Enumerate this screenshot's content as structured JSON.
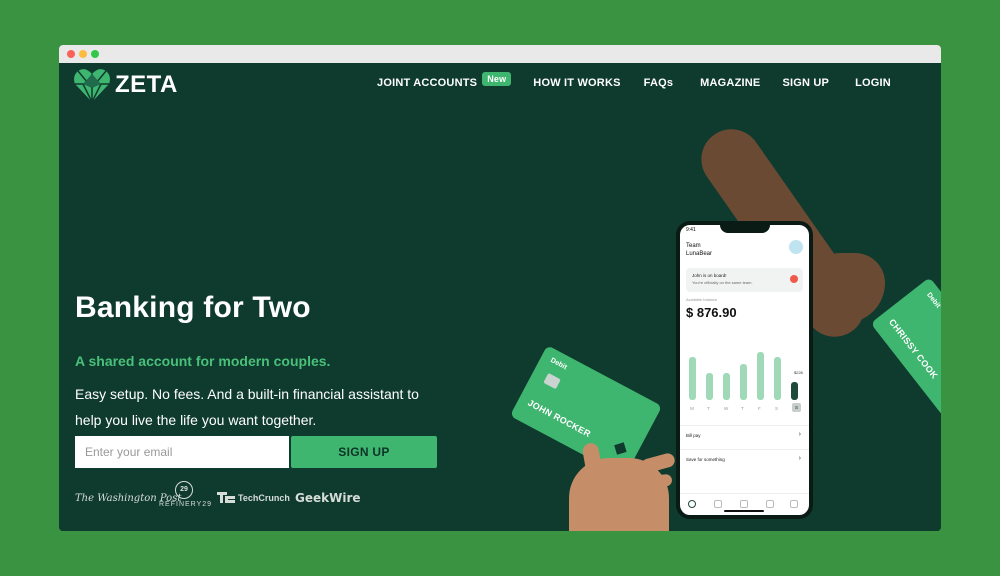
{
  "brand": {
    "name": "ZETA"
  },
  "nav": {
    "items": [
      {
        "label": "JOINT ACCOUNTS",
        "badge": "New"
      },
      {
        "label": "HOW IT WORKS"
      },
      {
        "label": "FAQs"
      },
      {
        "label": "MAGAZINE"
      },
      {
        "label": "SIGN UP"
      },
      {
        "label": "LOGIN"
      }
    ]
  },
  "hero": {
    "title": "Banking for Two",
    "subtitle": "A shared account for modern couples.",
    "description": "Easy setup. No fees. And a built-in financial assistant to help you live the life you want together.",
    "email_placeholder": "Enter your email",
    "signup_label": "SIGN UP"
  },
  "press": {
    "washington_post": "The Washington Post",
    "refinery29": "REFINERY29",
    "refinery29_mark": "29",
    "techcrunch": "TechCrunch",
    "geekwire": "GeekWire"
  },
  "phone": {
    "time": "9:41",
    "team_line1": "Team",
    "team_line2": "LunaBear",
    "notice_title": "John is on board!",
    "notice_body": "You're officially on the same team.",
    "balance_label": "Available balance",
    "balance": "$ 876.90",
    "amount_tag": "$226",
    "days": [
      "M",
      "T",
      "W",
      "T",
      "F",
      "S",
      "S"
    ],
    "bars": [
      0.62,
      0.38,
      0.38,
      0.52,
      0.68,
      0.62,
      0.26
    ],
    "rows": [
      "Bill pay",
      "Save for something"
    ]
  },
  "cards": {
    "card1_type": "Debit",
    "card1_name": "JOHN ROCKER",
    "card2_type": "Debit",
    "card2_name": "CHRISSY COOK"
  },
  "colors": {
    "page_bg": "#3a9341",
    "site_bg": "#0f3a2e",
    "accent": "#3fb66f",
    "subtitle": "#49c17a"
  }
}
